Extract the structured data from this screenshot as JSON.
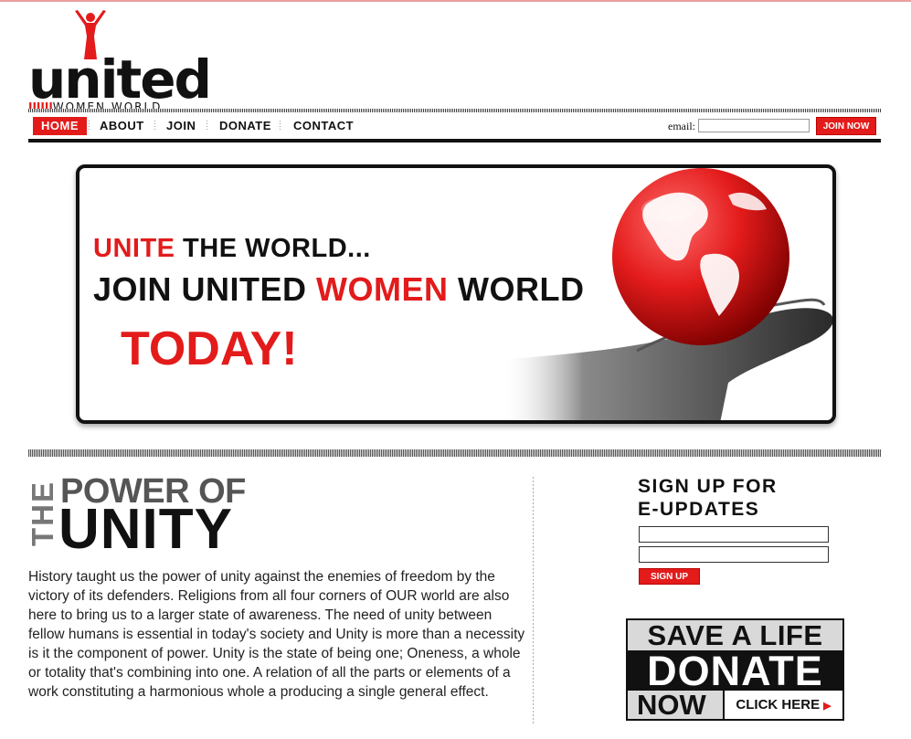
{
  "brand": {
    "logo_word": "united",
    "logo_bars": "IIIIII",
    "logo_sub": "WOMEN WORLD",
    "accent_color": "#e31b1b"
  },
  "nav": {
    "items": [
      {
        "label": "HOME",
        "active": true
      },
      {
        "label": "ABOUT",
        "active": false
      },
      {
        "label": "JOIN",
        "active": false
      },
      {
        "label": "DONATE",
        "active": false
      },
      {
        "label": "CONTACT",
        "active": false
      }
    ]
  },
  "email_signup": {
    "label": "email:",
    "value": "",
    "button": "JOIN NOW"
  },
  "banner": {
    "line1_red": "UNITE",
    "line1_black": " THE WORLD...",
    "line2_a": "JOIN UNITED ",
    "line2_red": "WOMEN",
    "line2_b": " WORLD",
    "line3": "TODAY!",
    "image_icon": "globe-in-hands-icon"
  },
  "article": {
    "heading_the": "THE",
    "heading_power": "POWER OF",
    "heading_unity": "UNITY",
    "body": "History taught us the power of unity against the enemies of freedom by the victory of its defenders. Religions from all four corners of OUR world are also here to bring us to a larger state of awareness. The need of unity between fellow humans is essential in today's society and Unity is more than a necessity is it the component of power. Unity is the state of being one; Oneness, a whole or totality that's combining into one. A relation of all the parts or elements of a work constituting a harmonious whole a producing a single general effect."
  },
  "eupdates": {
    "title_line1": "SIGN UP FOR",
    "title_line2": "E-UPDATES",
    "field1_value": "",
    "field2_value": "",
    "button": "SIGN UP"
  },
  "donate_box": {
    "save": "SAVE A LIFE",
    "donate": "DONATE",
    "now": "NOW",
    "click": "CLICK HERE"
  }
}
